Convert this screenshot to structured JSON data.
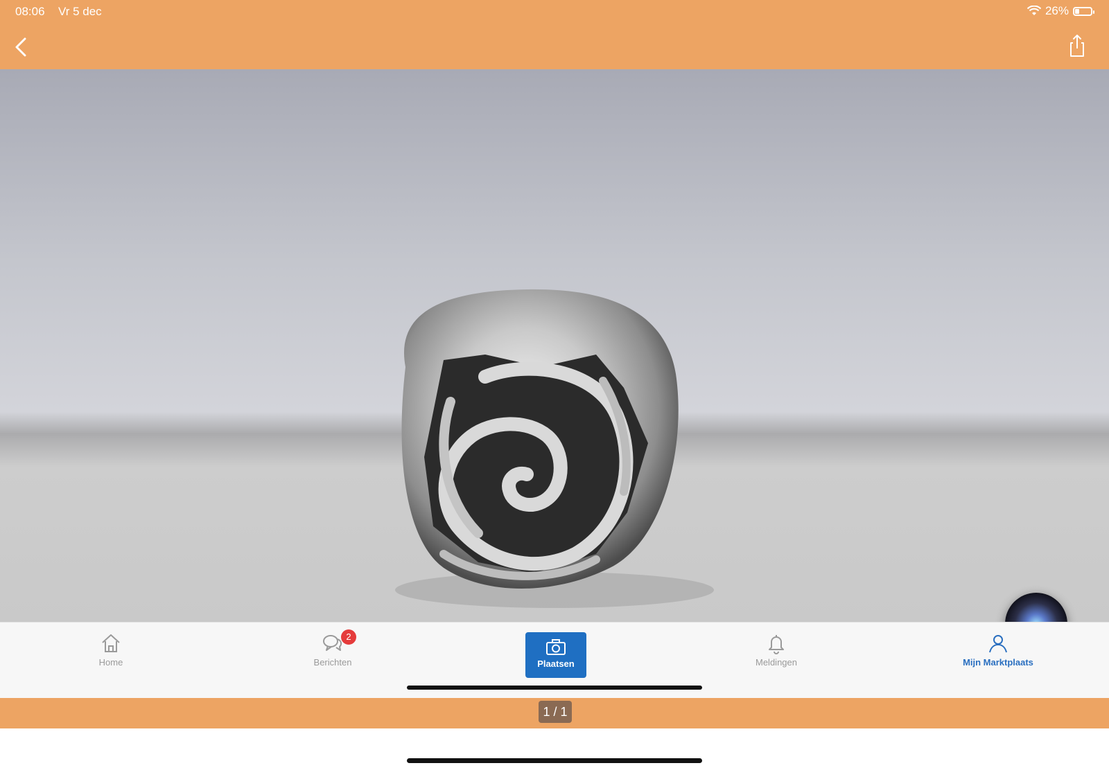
{
  "status_bar": {
    "time": "08:06",
    "date": "Vr 5 dec",
    "battery_text": "26%",
    "battery_level": 0.26
  },
  "nav": {
    "back_icon": "chevron-left-icon",
    "share_icon": "share-icon"
  },
  "tabs": {
    "home": {
      "label": "Home",
      "icon": "home-icon"
    },
    "messages": {
      "label": "Berichten",
      "icon": "chat-bubbles-icon",
      "badge": "2"
    },
    "place": {
      "label": "Plaatsen",
      "icon": "camera-icon"
    },
    "notifications": {
      "label": "Meldingen",
      "icon": "bell-icon"
    },
    "my_marktplaats": {
      "label": "Mijn Marktplaats",
      "icon": "person-icon"
    }
  },
  "gallery": {
    "counter": "1 / 1"
  },
  "colors": {
    "header": "#EDA463",
    "accent_blue": "#1f6fc2",
    "badge_red": "#e53b3b"
  }
}
